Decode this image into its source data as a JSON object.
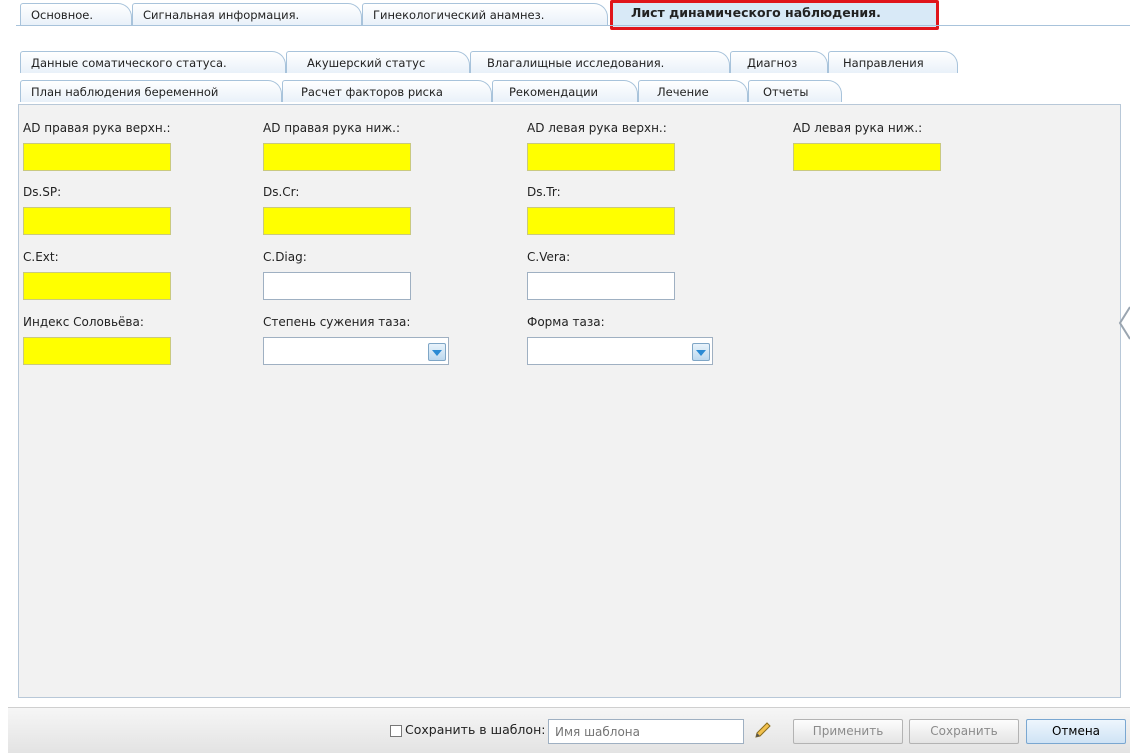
{
  "tabs": {
    "row1": [
      "Основное.",
      "Сигнальная информация.",
      "Гинекологический анамнез.",
      "Лист динамического наблюдения."
    ],
    "row2": [
      "Данные соматического статуса.",
      "Акушерский статус",
      "Влагалищные исследования.",
      "Диагноз",
      "Направления"
    ],
    "row3": [
      "План наблюдения беременной",
      "Расчет факторов риска",
      "Рекомендации",
      "Лечение",
      "Отчеты"
    ]
  },
  "form": {
    "ad_right_upper": "AD правая рука верхн.:",
    "ad_right_lower": "AD правая рука ниж.:",
    "ad_left_upper": "AD левая рука верхн.:",
    "ad_left_lower": "AD левая рука ниж.:",
    "ds_sp": "Ds.SP:",
    "ds_cr": "Ds.Cr:",
    "ds_tr": "Ds.Tr:",
    "c_ext": "C.Ext:",
    "c_diag": "C.Diag:",
    "c_vera": "C.Vera:",
    "soloviev_index": "Индекс Соловьёва:",
    "pelvis_narrowing": "Степень сужения таза:",
    "pelvis_shape": "Форма таза:"
  },
  "footer": {
    "save_template_label": "Сохранить в шаблон:",
    "template_placeholder": "Имя шаблона",
    "apply": "Применить",
    "save": "Сохранить",
    "cancel": "Отмена"
  },
  "colors": {
    "required_field": "#ffff00",
    "active_tab_highlight": "#e0151b"
  },
  "icons": {
    "edit": "pencil-icon",
    "dropdown": "chevron-down-icon",
    "collapse": "chevron-left-icon"
  }
}
